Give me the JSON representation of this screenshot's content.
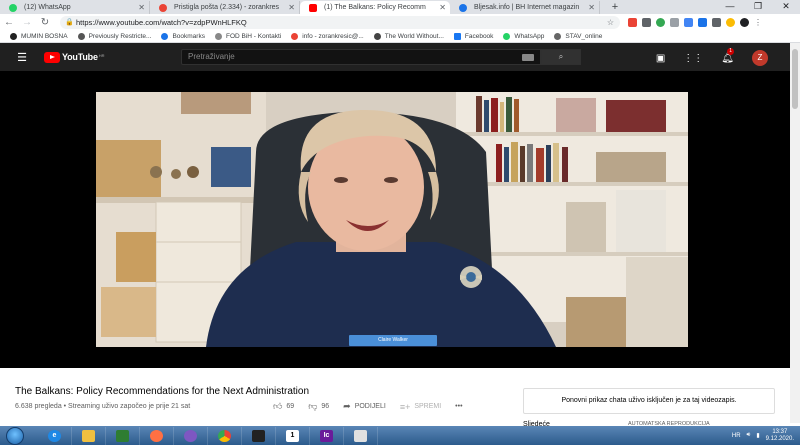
{
  "browser": {
    "tabs": [
      {
        "title": "(12) WhatsApp",
        "color": "#25d366",
        "active": false
      },
      {
        "title": "Pristigla pošta (2.334) - zorankres",
        "color": "#ea4335",
        "active": false
      },
      {
        "title": "(1) The Balkans: Policy Recomm",
        "color": "#ff0000",
        "active": true
      },
      {
        "title": "Bljesak.info | BH Internet magazin",
        "color": "#1a73e8",
        "active": false
      }
    ],
    "new_tab": "+",
    "url": "https://www.youtube.com/watch?v=zdpPWnHLFKQ",
    "bookmarks": [
      {
        "label": "MUMIN BOSNA",
        "color": "#222222"
      },
      {
        "label": "Previously Restricte...",
        "color": "#555555"
      },
      {
        "label": "Bookmarks",
        "color": "#1a73e8"
      },
      {
        "label": "FOD BiH - Kontakti",
        "color": "#888888"
      },
      {
        "label": "info - zorankresic@...",
        "color": "#ea4335"
      },
      {
        "label": "The World Without...",
        "color": "#444444"
      },
      {
        "label": "Facebook",
        "color": "#1877f2"
      },
      {
        "label": "WhatsApp",
        "color": "#25d366"
      },
      {
        "label": "STAV_online",
        "color": "#666666"
      }
    ]
  },
  "youtube": {
    "logo": "YouTube",
    "country_code": "HR",
    "search_placeholder": "Pretraživanje",
    "notification_count": "1",
    "avatar_letter": "Z",
    "video": {
      "title": "The Balkans: Policy Recommendations for the Next Administration",
      "meta": "6.638 pregleda • Streaming uživo započeo je prije 21 sat",
      "likes": "69",
      "dislikes": "96",
      "share": "PODIJELI",
      "save": "SPREMI",
      "more": "•••",
      "nameplate": "Claire Walker"
    },
    "chat_notice": "Ponovni prikaz chata uživo isključen je za taj videozapis.",
    "up_next": "Sljedeće",
    "autoplay": "AUTOMATSKA REPRODUKCIJA"
  },
  "taskbar": {
    "language": "HR",
    "time": "13:37",
    "date": "9.12.2020."
  },
  "colors": {
    "yt_red": "#ff0000",
    "yt_header": "#202020",
    "player_bg": "#000000"
  }
}
